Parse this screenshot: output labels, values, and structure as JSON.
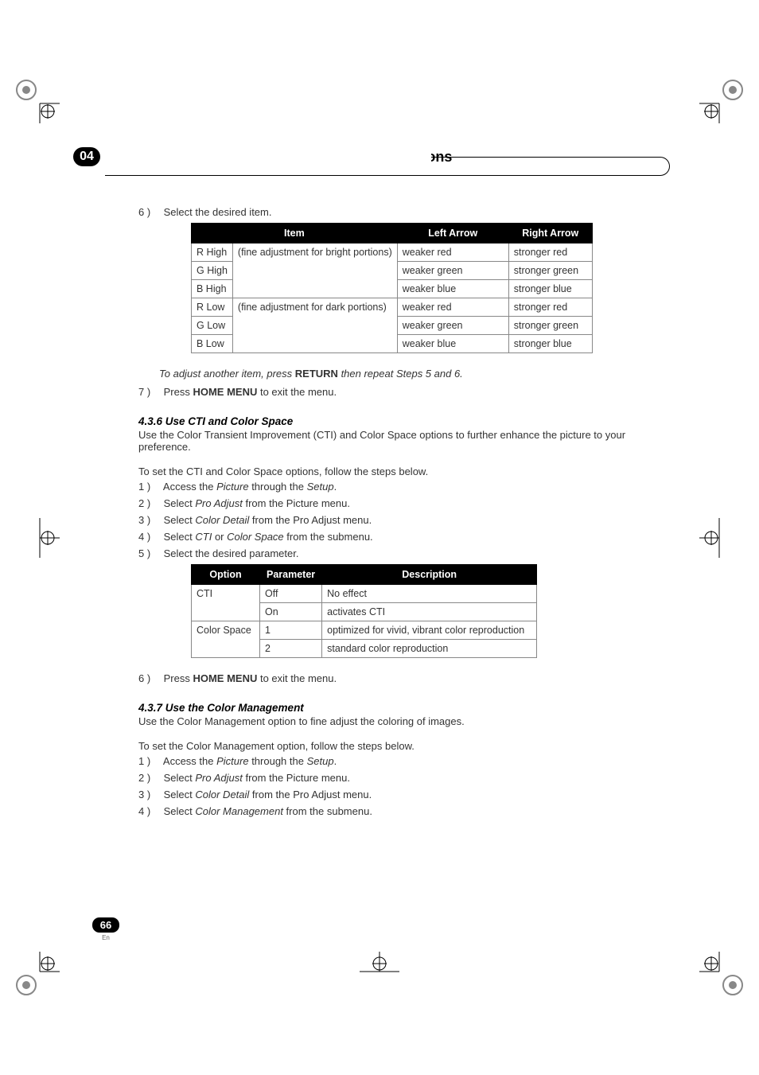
{
  "chapter": {
    "number": "04",
    "title": "Additional Picture and Sound Adjustment Options"
  },
  "step6": {
    "num": "6 )",
    "text": "Select the desired item."
  },
  "table1": {
    "headers": [
      "Item",
      "",
      "Left Arrow",
      "Right Arrow"
    ],
    "rows": [
      [
        "R High",
        "(fine adjustment for bright portions)",
        "weaker red",
        "stronger red"
      ],
      [
        "G High",
        "",
        "weaker green",
        "stronger green"
      ],
      [
        "B High",
        "",
        "weaker blue",
        "stronger blue"
      ],
      [
        "R Low",
        "(fine adjustment for dark portions)",
        "weaker red",
        "stronger red"
      ],
      [
        "G Low",
        "",
        "weaker green",
        "stronger green"
      ],
      [
        "B Low",
        "",
        "weaker blue",
        "stronger blue"
      ]
    ]
  },
  "note1": {
    "pre": "To adjust another item, press ",
    "bold": "RETURN",
    "post": " then repeat Steps 5 and 6."
  },
  "step7": {
    "num": "7 )",
    "pre": "Press ",
    "bold": "HOME MENU",
    "post": " to exit the menu."
  },
  "section436": {
    "heading": "4.3.6  Use CTI and Color Space",
    "intro": "Use the Color Transient Improvement (CTI) and Color Space options to further enhance the picture to your preference.",
    "lead": "To set the CTI and Color Space options, follow the steps below.",
    "s1": {
      "num": "1 )",
      "pre": "Access the ",
      "i1": "Picture",
      "mid": " through the ",
      "i2": "Setup",
      "post": "."
    },
    "s2": {
      "num": "2 )",
      "pre": "Select ",
      "i1": "Pro Adjust",
      "post": " from the Picture menu."
    },
    "s3": {
      "num": "3 )",
      "pre": "Select ",
      "i1": "Color Detail",
      "post": " from the Pro Adjust menu."
    },
    "s4": {
      "num": "4 )",
      "pre": "Select ",
      "i1": "CTI",
      "mid": " or ",
      "i2": "Color Space",
      "post": " from the submenu."
    },
    "s5": {
      "num": "5 )",
      "text": "Select the desired parameter."
    }
  },
  "table2": {
    "headers": [
      "Option",
      "Parameter",
      "Description"
    ],
    "rows": [
      [
        "CTI",
        "Off",
        "No effect"
      ],
      [
        "",
        "On",
        "activates CTI"
      ],
      [
        "Color Space",
        "1",
        "optimized for vivid, vibrant color reproduction"
      ],
      [
        "",
        "2",
        "standard color reproduction"
      ]
    ]
  },
  "section436_s6": {
    "num": "6 )",
    "pre": "Press ",
    "bold": "HOME MENU",
    "post": " to exit the menu."
  },
  "section437": {
    "heading": "4.3.7  Use the Color Management",
    "intro": "Use the Color Management option to fine adjust the coloring of images.",
    "lead": "To set the Color Management option, follow the steps below.",
    "s1": {
      "num": "1 )",
      "pre": "Access the ",
      "i1": "Picture",
      "mid": " through the ",
      "i2": "Setup",
      "post": "."
    },
    "s2": {
      "num": "2 )",
      "pre": "Select ",
      "i1": "Pro Adjust",
      "post": " from the Picture menu."
    },
    "s3": {
      "num": "3 )",
      "pre": "Select ",
      "i1": "Color Detail",
      "post": " from the Pro Adjust menu."
    },
    "s4": {
      "num": "4 )",
      "pre": "Select ",
      "i1": "Color Management",
      "post": " from the submenu."
    }
  },
  "footer": {
    "page": "66",
    "lang": "En"
  }
}
